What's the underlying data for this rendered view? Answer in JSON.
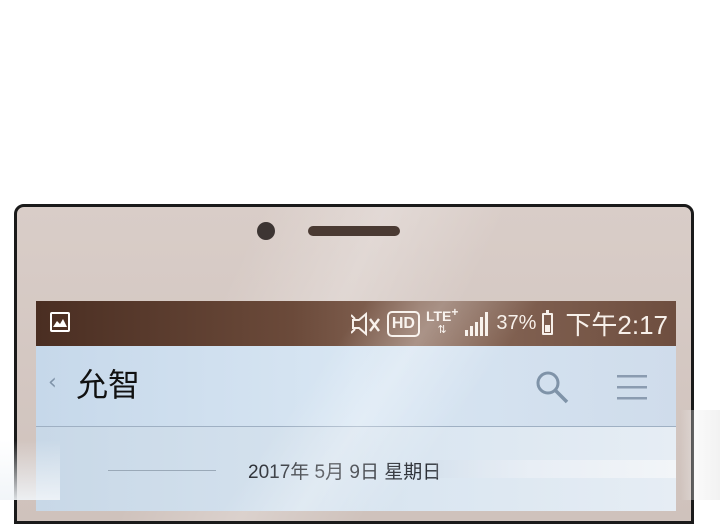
{
  "status_bar": {
    "left_icon": "gallery-notification-icon",
    "icons": [
      "mute-icon",
      "hd-voice-icon",
      "lte-icon",
      "signal-icon"
    ],
    "hd_label": "HD",
    "network_label": "LTE",
    "network_plus": "+",
    "battery_percent": "37%",
    "battery_level": 0.37,
    "time": "下午2:17"
  },
  "app_bar": {
    "back_icon": "chevron-left-icon",
    "back_glyph": "‹",
    "title": "允智",
    "actions": [
      "search-icon",
      "menu-icon"
    ]
  },
  "chat": {
    "date_divider": "2017年 5月 9日 星期日"
  },
  "colors": {
    "status_bar": "#5a3b2d",
    "app_bar": "#cfdfee",
    "bezel": "#d4c7c1"
  }
}
